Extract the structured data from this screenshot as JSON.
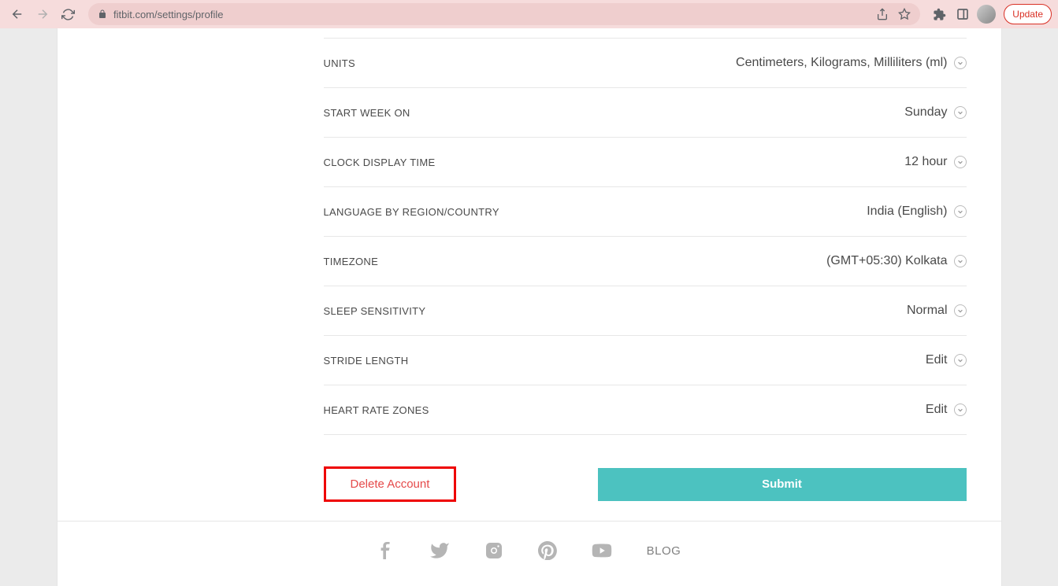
{
  "browser": {
    "url": "fitbit.com/settings/profile",
    "update_label": "Update"
  },
  "settings": [
    {
      "label": "UNITS",
      "value": "Centimeters, Kilograms, Milliliters (ml)"
    },
    {
      "label": "START WEEK ON",
      "value": "Sunday"
    },
    {
      "label": "CLOCK DISPLAY TIME",
      "value": "12 hour"
    },
    {
      "label": "LANGUAGE BY REGION/COUNTRY",
      "value": "India (English)"
    },
    {
      "label": "TIMEZONE",
      "value": "(GMT+05:30) Kolkata"
    },
    {
      "label": "SLEEP SENSITIVITY",
      "value": "Normal"
    },
    {
      "label": "STRIDE LENGTH",
      "value": "Edit"
    },
    {
      "label": "HEART RATE ZONES",
      "value": "Edit"
    }
  ],
  "actions": {
    "delete_label": "Delete Account",
    "submit_label": "Submit"
  },
  "footer": {
    "blog_label": "BLOG"
  }
}
